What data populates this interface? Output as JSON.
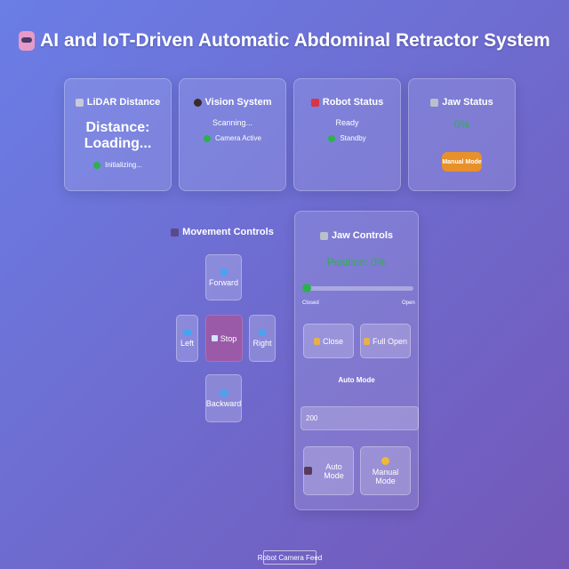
{
  "header": {
    "title": "AI and IoT-Driven Automatic Abdominal Retractor System"
  },
  "lidar": {
    "title": "LiDAR Distance",
    "distance": "Distance: Loading...",
    "status": "Initializing..."
  },
  "vision": {
    "title": "Vision System",
    "state": "Scanning...",
    "status": "Camera Active"
  },
  "robot": {
    "title": "Robot Status",
    "state": "Ready",
    "status": "Standby"
  },
  "jaw_status": {
    "title": "Jaw Status",
    "percent": "0%",
    "mode_badge": "Manual Mode"
  },
  "movement": {
    "title": "Movement Controls",
    "forward": "Forward",
    "left": "Left",
    "stop": "Stop",
    "right": "Right",
    "backward": "Backward"
  },
  "jaw_controls": {
    "title": "Jaw Controls",
    "position": "Position: 0%",
    "slider_level": 0,
    "slider_min_label": "Closed",
    "slider_max_label": "Open",
    "close_button": "Close",
    "full_open_button": "Full Open",
    "auto_mode_heading": "Auto Mode",
    "auto_value": "200",
    "auto_mode_button": "Auto Mode",
    "manual_mode_button": "Manual Mode"
  },
  "camera_feed": {
    "alt": "Robot Camera Feed"
  },
  "colors": {
    "status_green": "#2bb24c",
    "badge_orange": "#e8902a",
    "stop_purple": "#9a5aa8"
  }
}
